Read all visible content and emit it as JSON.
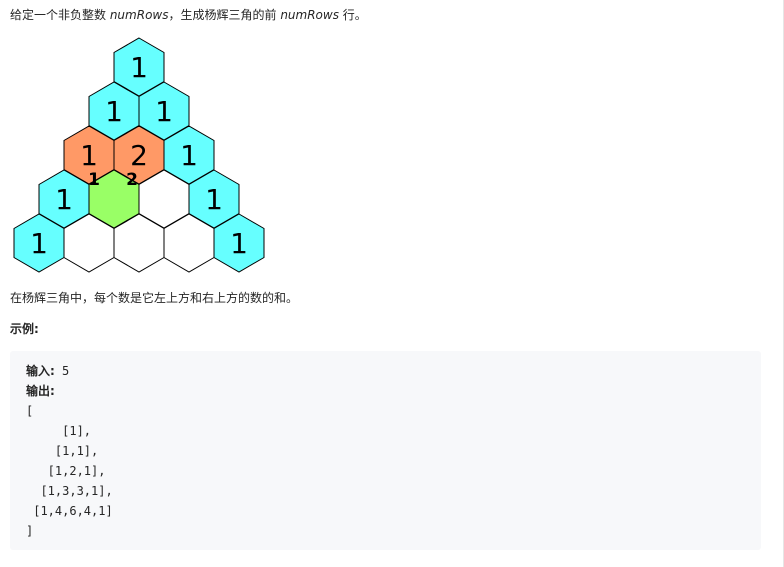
{
  "intro": {
    "prefix": "给定一个非负整数 ",
    "var1": "numRows",
    "middle": "，生成杨辉三角的前 ",
    "var2": "numRows",
    "suffix": " 行。"
  },
  "figure": {
    "colors": {
      "cyan": "#66ffff",
      "orange": "#ff9966",
      "green": "#99ff66",
      "white": "#ffffff",
      "stroke": "#000000"
    },
    "rows": [
      [
        {
          "label": "1",
          "fill": "cyan"
        }
      ],
      [
        {
          "label": "1",
          "fill": "cyan"
        },
        {
          "label": "1",
          "fill": "cyan"
        }
      ],
      [
        {
          "label": "1",
          "fill": "orange"
        },
        {
          "label": "2",
          "fill": "orange"
        },
        {
          "label": "1",
          "fill": "cyan"
        }
      ],
      [
        {
          "label": "1",
          "fill": "cyan"
        },
        {
          "label": "",
          "fill": "green"
        },
        {
          "label": "",
          "fill": "white"
        },
        {
          "label": "1",
          "fill": "cyan"
        }
      ],
      [
        {
          "label": "1",
          "fill": "cyan"
        },
        {
          "label": "",
          "fill": "white"
        },
        {
          "label": "",
          "fill": "white"
        },
        {
          "label": "",
          "fill": "white"
        },
        {
          "label": "1",
          "fill": "cyan"
        }
      ]
    ],
    "annotations": [
      "1",
      "2"
    ]
  },
  "description": "在杨辉三角中，每个数是它左上方和右上方的数的和。",
  "example": {
    "heading": "示例:",
    "input_label": "输入:",
    "input_value": " 5",
    "output_label": "输出:",
    "output_lines": [
      "[",
      "     [1],",
      "    [1,1],",
      "   [1,2,1],",
      "  [1,3,3,1],",
      " [1,4,6,4,1]",
      "]"
    ]
  }
}
